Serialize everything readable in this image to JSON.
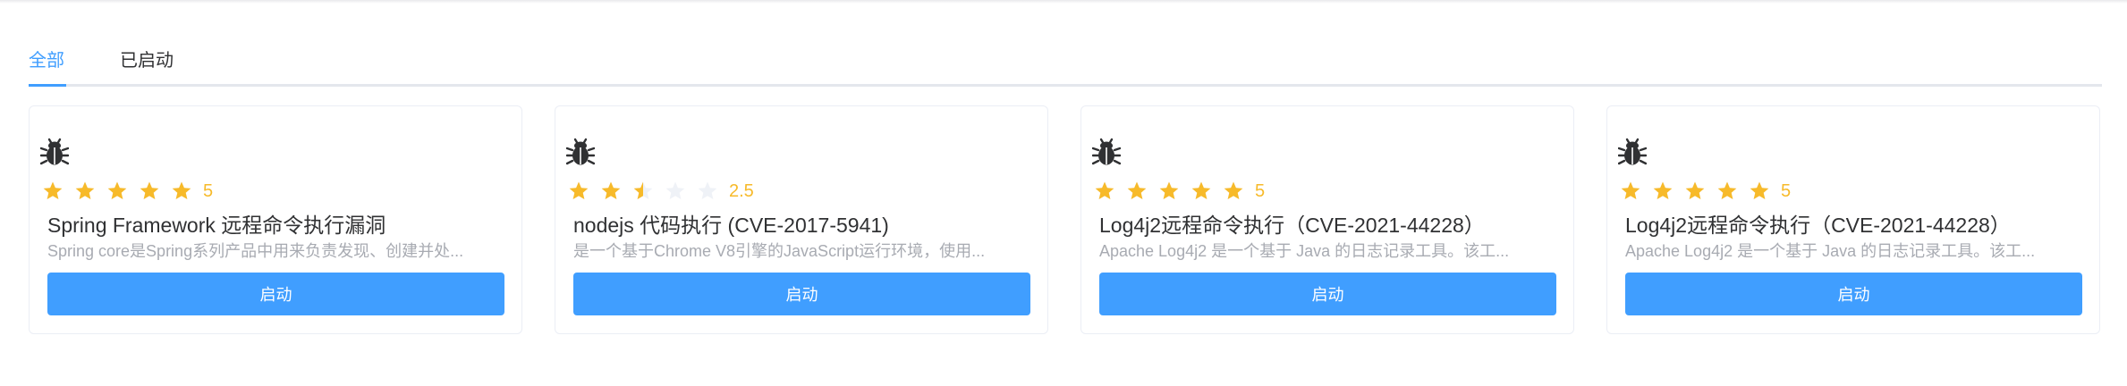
{
  "tabs": [
    {
      "label": "全部",
      "active": true
    },
    {
      "label": "已启动",
      "active": false
    }
  ],
  "colors": {
    "accent": "#409eff",
    "star_filled": "#f7ba2a",
    "star_empty": "#eff2f7",
    "icon": "#303133"
  },
  "cards": [
    {
      "icon": "bug-icon",
      "rating": 5,
      "rating_label": "5",
      "title": "Spring Framework 远程命令执行漏洞",
      "description": "Spring core是Spring系列产品中用来负责发现、创建并处...",
      "button_label": "启动"
    },
    {
      "icon": "bug-icon",
      "rating": 2.5,
      "rating_label": "2.5",
      "title": "nodejs 代码执行 (CVE-2017-5941)",
      "description": "是一个基于Chrome V8引擎的JavaScript运行环境，使用...",
      "button_label": "启动"
    },
    {
      "icon": "bug-icon",
      "rating": 5,
      "rating_label": "5",
      "title": "Log4j2远程命令执行（CVE-2021-44228）",
      "description": "Apache Log4j2 是一个基于 Java 的日志记录工具。该工...",
      "button_label": "启动"
    },
    {
      "icon": "bug-icon",
      "rating": 5,
      "rating_label": "5",
      "title": "Log4j2远程命令执行（CVE-2021-44228）",
      "description": "Apache Log4j2 是一个基于 Java 的日志记录工具。该工...",
      "button_label": "启动"
    }
  ]
}
